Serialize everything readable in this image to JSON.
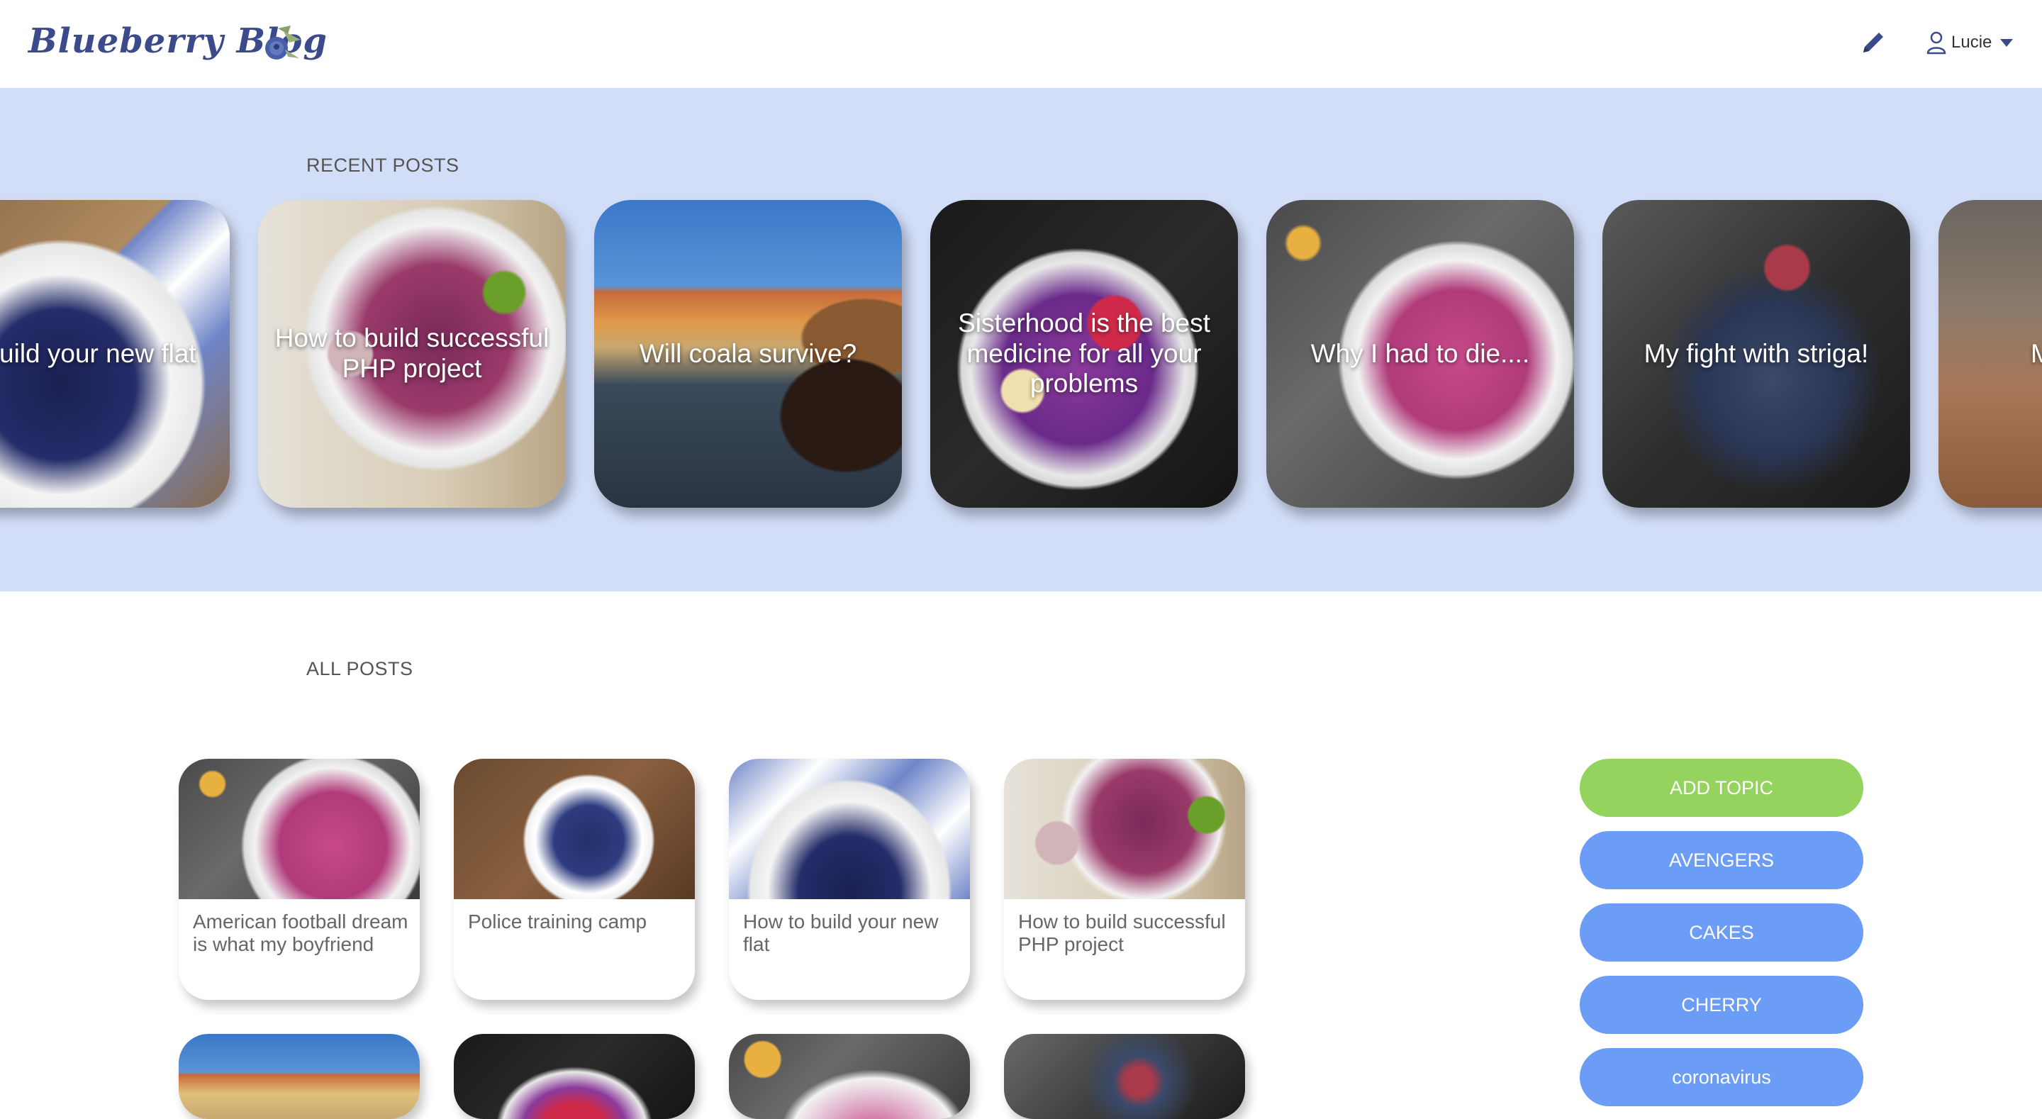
{
  "header": {
    "logo": "Blueberry Blog",
    "user_name": "Lucie"
  },
  "recent": {
    "title": "RECENT POSTS",
    "cards": [
      "to build your new flat",
      "How to build successful PHP project",
      "Will coala survive?",
      "Sisterhood is the best medicine for all your problems",
      "Why I had to die....",
      "My fight with striga!",
      "M"
    ]
  },
  "all": {
    "title": "ALL POSTS",
    "cards": [
      "American football dream is what my boyfriend",
      "Police training camp",
      "How to build your new flat",
      "How to build successful PHP project"
    ]
  },
  "topics": {
    "add_label": "ADD TOPIC",
    "items": [
      "AVENGERS",
      "CAKES",
      "CHERRY",
      "coronavirus"
    ],
    "colors": {
      "add": "#95d35f",
      "topic": "#6b9cf6"
    }
  }
}
